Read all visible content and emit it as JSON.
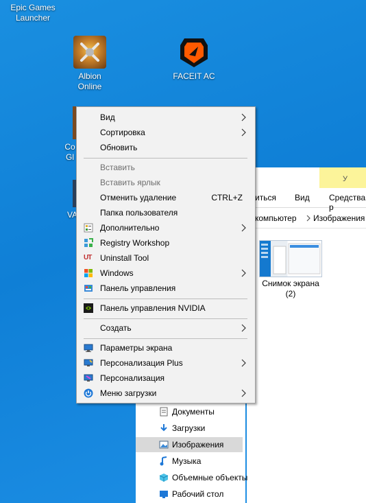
{
  "desktop": {
    "icons": [
      {
        "label": "Epic Games Launcher"
      },
      {
        "label": "Albion Online"
      },
      {
        "label": "FACEIT AC"
      },
      {
        "label": "Co Glo"
      },
      {
        "label": "VA"
      }
    ]
  },
  "explorer": {
    "ribbon_tabs": [
      "иться",
      "Вид",
      "Средства р",
      "У"
    ],
    "address": [
      "компьютер",
      "Изображения"
    ],
    "file": {
      "name_line1": "Снимок экрана",
      "name_line2": "(2)"
    },
    "nav_items": [
      "Документы",
      "Загрузки",
      "Изображения",
      "Музыка",
      "Объемные объекты",
      "Рабочий стол"
    ]
  },
  "context_menu": {
    "items": [
      {
        "label": "Вид",
        "submenu": true
      },
      {
        "label": "Сортировка",
        "submenu": true
      },
      {
        "label": "Обновить"
      },
      {
        "label": "Вставить",
        "disabled": true
      },
      {
        "label": "Вставить ярлык",
        "disabled": true
      },
      {
        "label": "Отменить удаление",
        "shortcut": "CTRL+Z"
      },
      {
        "label": "Папка пользователя"
      },
      {
        "label": "Дополнительно",
        "submenu": true,
        "icon": "additional-icon"
      },
      {
        "label": "Registry Workshop",
        "icon": "registry-workshop-icon"
      },
      {
        "label": "Uninstall Tool",
        "icon": "uninstall-tool-icon"
      },
      {
        "label": "Windows",
        "submenu": true,
        "icon": "windows-icon"
      },
      {
        "label": "Панель управления",
        "icon": "control-panel-icon"
      },
      {
        "label": "Панель управления NVIDIA",
        "icon": "nvidia-icon"
      },
      {
        "label": "Создать",
        "submenu": true
      },
      {
        "label": "Параметры экрана",
        "icon": "display-settings-icon"
      },
      {
        "label": "Персонализация Plus",
        "submenu": true,
        "icon": "personalization-plus-icon"
      },
      {
        "label": "Персонализация",
        "icon": "personalization-icon"
      },
      {
        "label": "Меню загрузки",
        "submenu": true,
        "icon": "boot-menu-icon"
      }
    ]
  },
  "colors": {
    "desktop_bg": "#0f7fd6",
    "menu_bg": "#f2f2f2",
    "ribbon_highlight": "#fcf49a"
  }
}
